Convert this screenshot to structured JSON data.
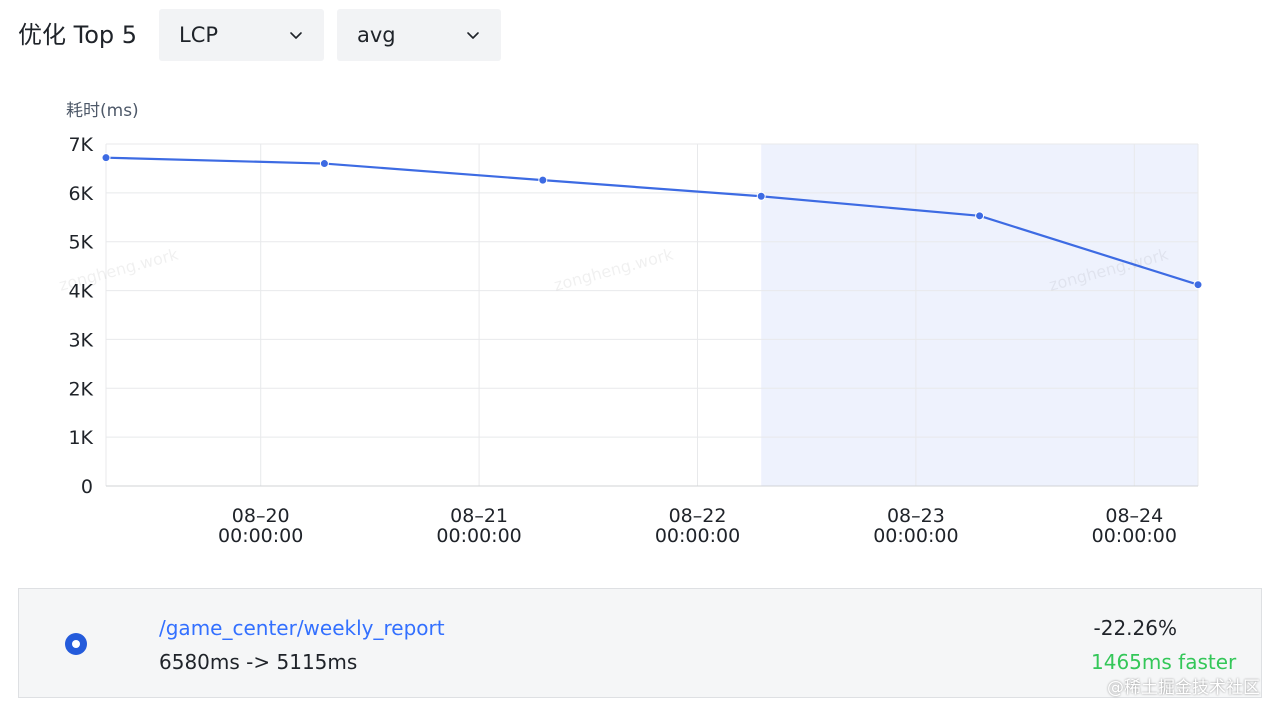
{
  "header": {
    "title": "优化 Top 5",
    "metric_select": {
      "value": "LCP",
      "icon": "chevron-down-icon"
    },
    "aggregate_select": {
      "value": "avg",
      "icon": "chevron-down-icon"
    }
  },
  "chart_data": {
    "type": "line",
    "ylabel": "耗时(ms)",
    "ylim": [
      0,
      7000
    ],
    "y_ticks": [
      0,
      1000,
      2000,
      3000,
      4000,
      5000,
      6000,
      7000
    ],
    "y_tick_labels": [
      "0",
      "1K",
      "2K",
      "3K",
      "4K",
      "5K",
      "6K",
      "7K"
    ],
    "x_domain": [
      "08-19 07:00:00",
      "08-24 07:00:00"
    ],
    "x_ticks": [
      {
        "value": "08-20 00:00:00",
        "label_date": "08–20",
        "label_time": "00:00:00"
      },
      {
        "value": "08-21 00:00:00",
        "label_date": "08–21",
        "label_time": "00:00:00"
      },
      {
        "value": "08-22 00:00:00",
        "label_date": "08–22",
        "label_time": "00:00:00"
      },
      {
        "value": "08-23 00:00:00",
        "label_date": "08–23",
        "label_time": "00:00:00"
      },
      {
        "value": "08-24 00:00:00",
        "label_date": "08–24",
        "label_time": "00:00:00"
      }
    ],
    "highlight_range": [
      "08-22 07:00:00",
      "08-24 07:00:00"
    ],
    "grid": true,
    "legend": "none",
    "series": [
      {
        "color": "#3d6be3",
        "points": [
          {
            "x": "08-19 07:00:00",
            "y": 6720
          },
          {
            "x": "08-20 07:00:00",
            "y": 6600
          },
          {
            "x": "08-21 07:00:00",
            "y": 6260
          },
          {
            "x": "08-22 07:00:00",
            "y": 5930
          },
          {
            "x": "08-23 07:00:00",
            "y": 5530
          },
          {
            "x": "08-24 07:00:00",
            "y": 4120
          }
        ]
      }
    ],
    "watermark": "zongheng.work"
  },
  "legend_item": {
    "route": "/game_center/weekly_report",
    "timing": "6580ms -> 5115ms",
    "delta_percent": "-22.26%",
    "delta_ms": "1465ms faster",
    "radio_color": "#245bdb",
    "faster_color": "#34c759"
  },
  "attribution": "@稀土掘金技术社区"
}
